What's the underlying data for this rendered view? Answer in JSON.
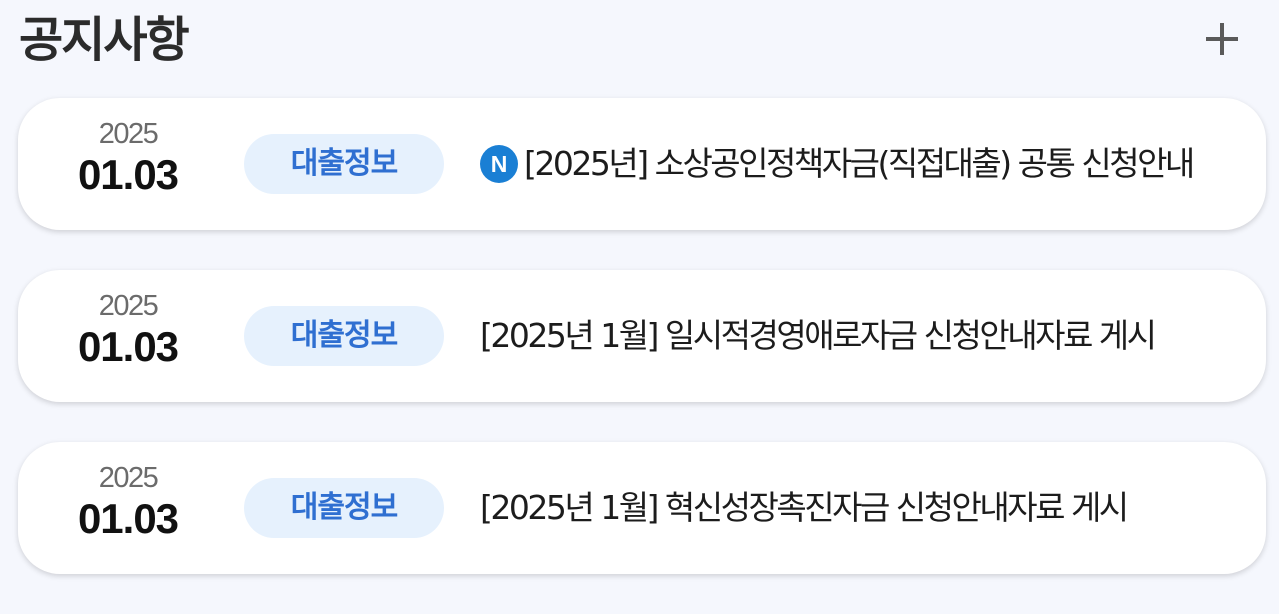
{
  "header": {
    "title": "공지사항",
    "more_icon": "plus-icon"
  },
  "notices": [
    {
      "year": "2025",
      "day": "01.03",
      "category": "대출정보",
      "is_new": true,
      "new_label": "N",
      "title": "[2025년] 소상공인정책자금(직접대출) 공통 신청안내"
    },
    {
      "year": "2025",
      "day": "01.03",
      "category": "대출정보",
      "is_new": false,
      "title": "[2025년 1월] 일시적경영애로자금 신청안내자료 게시"
    },
    {
      "year": "2025",
      "day": "01.03",
      "category": "대출정보",
      "is_new": false,
      "title": "[2025년 1월] 혁신성장촉진자금 신청안내자료 게시"
    }
  ],
  "colors": {
    "background": "#f5f7fd",
    "badge_bg": "#e6f1fd",
    "badge_text": "#2f6fd1",
    "new_badge": "#1a7fd4"
  }
}
